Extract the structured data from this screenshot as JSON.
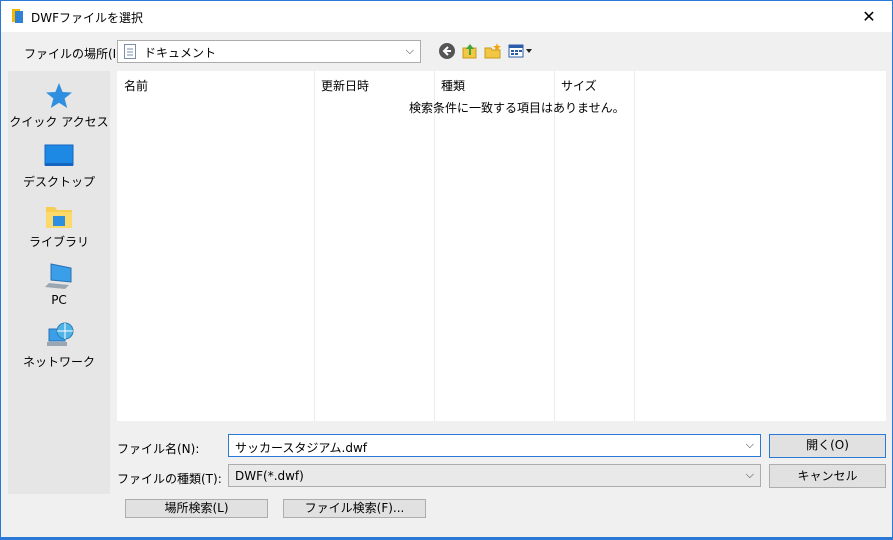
{
  "window": {
    "title": "DWFファイルを選択",
    "close_glyph": "✕",
    "accent_color": "#2b79d6"
  },
  "lookin": {
    "label": "ファイルの場所(I):",
    "value": "ドキュメント",
    "arrow": "⌵"
  },
  "toolbar": {
    "back_icon": "back-icon",
    "up_icon": "up-folder-icon",
    "newfolder_icon": "new-folder-icon",
    "view_icon": "view-menu-icon"
  },
  "places": [
    {
      "label": "クイック アクセス",
      "icon": "quick-access-star-icon"
    },
    {
      "label": "デスクトップ",
      "icon": "desktop-icon"
    },
    {
      "label": "ライブラリ",
      "icon": "library-icon"
    },
    {
      "label": "PC",
      "icon": "pc-icon"
    },
    {
      "label": "ネットワーク",
      "icon": "network-icon"
    }
  ],
  "filelist": {
    "columns": [
      "名前",
      "更新日時",
      "種類",
      "サイズ"
    ],
    "empty_message": "検索条件に一致する項目はありません。"
  },
  "filename": {
    "label": "ファイル名(N):",
    "value": "サッカースタジアム.dwf",
    "arrow": "⌵"
  },
  "filetype": {
    "label": "ファイルの種類(T):",
    "value": "DWF(*.dwf)",
    "arrow": "⌵"
  },
  "buttons": {
    "open": "開く(O)",
    "cancel": "キャンセル",
    "place_search": "場所検索(L)",
    "file_search": "ファイル検索(F)..."
  }
}
